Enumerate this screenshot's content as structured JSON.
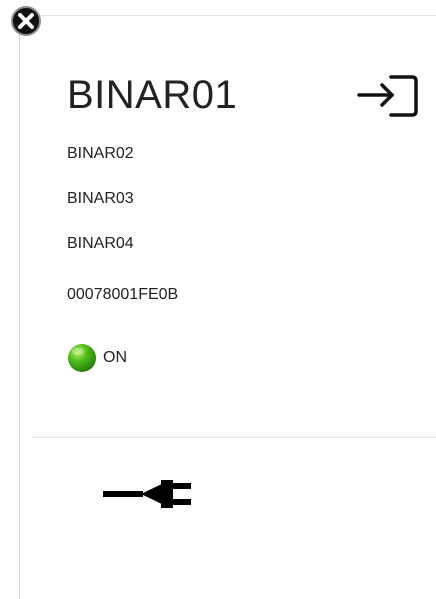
{
  "device": {
    "title": "BINAR01",
    "lines": [
      "BINAR02",
      "BINAR03",
      "BINAR04",
      "00078001FE0B"
    ],
    "status": {
      "text": "ON",
      "color": "#2f9e0f"
    }
  },
  "icons": {
    "close": "close-icon",
    "login": "sign-in-icon",
    "status": "status-led-icon",
    "plug": "power-plug-icon"
  },
  "colors": {
    "text": "#222222",
    "divider": "#e3e3e3",
    "led": "#2f9e0f"
  }
}
